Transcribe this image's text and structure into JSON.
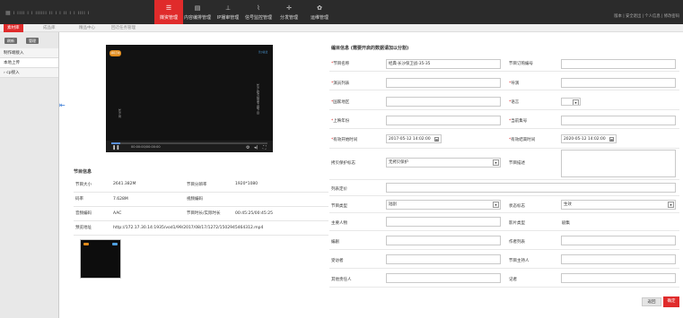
{
  "header": {
    "logo_text": "▦ ı ıııı ı ı ıııııı ıı ı ı ıı ı ı ıııı ı",
    "nav": [
      {
        "label": "媒资管理",
        "icon": "cabinet-icon",
        "glyph": "☰"
      },
      {
        "label": "内容编排管理",
        "icon": "layout-icon",
        "glyph": "▤"
      },
      {
        "label": "IP播审管理",
        "icon": "network-icon",
        "glyph": "⊥"
      },
      {
        "label": "信号监控管理",
        "icon": "signal-icon",
        "glyph": "⌇"
      },
      {
        "label": "分发管理",
        "icon": "distribute-icon",
        "glyph": "✛"
      },
      {
        "label": "运维管理",
        "icon": "gear-icon",
        "glyph": "✿"
      }
    ],
    "right_links": "版本 | 安全退出 | 个人信息 | 修改密码",
    "accent_color": "#e02b2b"
  },
  "subnav": {
    "tabs": [
      "素材库",
      "成品库",
      "精品中心",
      "回迁任务管理"
    ]
  },
  "sidebar": {
    "buttons": [
      "刷新",
      "管理"
    ],
    "items": [
      "制作端接入",
      "本地上传",
      "cp接入"
    ]
  },
  "player": {
    "left_logo": "湖南卫视",
    "right_logo": "长沙政法",
    "left_vertical_text": "长沙局",
    "right_vertical_text": "长沙政法频道专题节目",
    "time": "00:00:00/00:00:00",
    "progress": 0.06
  },
  "info": {
    "title": "节目信息",
    "rows": [
      [
        "节目大小",
        "2641.382M",
        "节目分辨率",
        "1920*1080"
      ],
      [
        "码率",
        "7.628M",
        "视频编码",
        ""
      ],
      [
        "音频编码",
        "AAC",
        "节目时长/实际时长",
        "00:45:25/00:45:25"
      ],
      [
        "预览地址",
        "http://172.17.30.14:1935/vod1/99/2017/08/17/1272/1502945464312.mp4",
        "",
        ""
      ]
    ]
  },
  "form": {
    "title": "编目信息 (需要开启的数据请加以分割)",
    "program_name_label": "节目名称",
    "program_name_value": "经典·长沙保卫战-35-35",
    "order_no_label": "节目订购编号",
    "actor_label": "演员列表",
    "director_label": "导演",
    "region_label": "国家地区",
    "language_label": "语言",
    "year_label": "上映年份",
    "episode_label": "当前集号",
    "start_label": "有效开始时间",
    "start_value": "2017-05-12 14:02:00",
    "end_label": "有效结束时间",
    "end_value": "2020-05-12 14:02:00",
    "copyright_label": "拷贝保护标志",
    "copyright_value": "无拷贝保护",
    "description_label": "节目描述",
    "keywords_label": "列表定价",
    "type_label": "节目类型",
    "type_value": "短剧",
    "status_label": "状态标志",
    "status_value": "生效",
    "host_label": "主要人物",
    "film_type_label": "影片类型",
    "film_type_value": "剧集",
    "writer_label": "编剧",
    "author_label": "作者列表",
    "interviewee_label": "受访者",
    "presenter_label": "节目主持人",
    "other_label": "其他责任人",
    "reporter_label": "记者"
  },
  "actions": {
    "back": "返回",
    "confirm": "确定"
  }
}
